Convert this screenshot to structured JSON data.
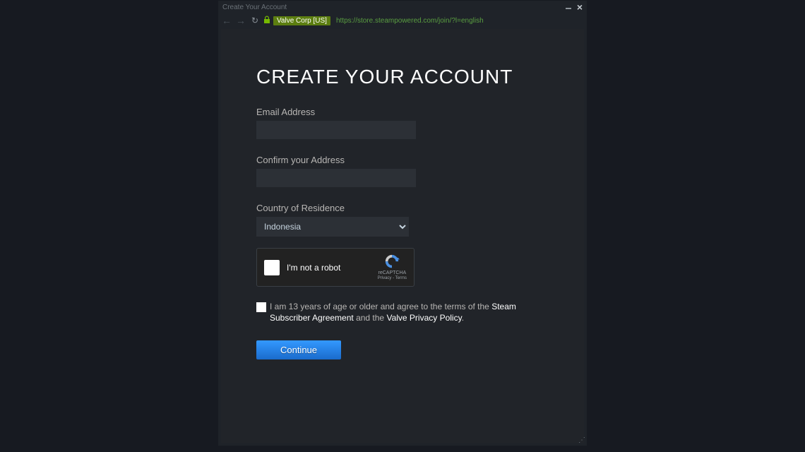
{
  "window": {
    "title": "Create Your Account",
    "cert_badge": "Valve Corp [US]",
    "url": "https://store.steampowered.com/join/?l=english"
  },
  "page": {
    "heading": "CREATE YOUR ACCOUNT"
  },
  "form": {
    "email_label": "Email Address",
    "email_value": "",
    "confirm_label": "Confirm your Address",
    "confirm_value": "",
    "country_label": "Country of Residence",
    "country_selected": "Indonesia"
  },
  "recaptcha": {
    "label": "I'm not a robot",
    "brand": "reCAPTCHA",
    "terms": "Privacy - Terms"
  },
  "agreement": {
    "prefix": "I am 13 years of age or older and agree to the terms of the ",
    "link1": "Steam Subscriber Agreement",
    "mid": " and the ",
    "link2": "Valve Privacy Policy",
    "suffix": "."
  },
  "buttons": {
    "continue": "Continue"
  }
}
